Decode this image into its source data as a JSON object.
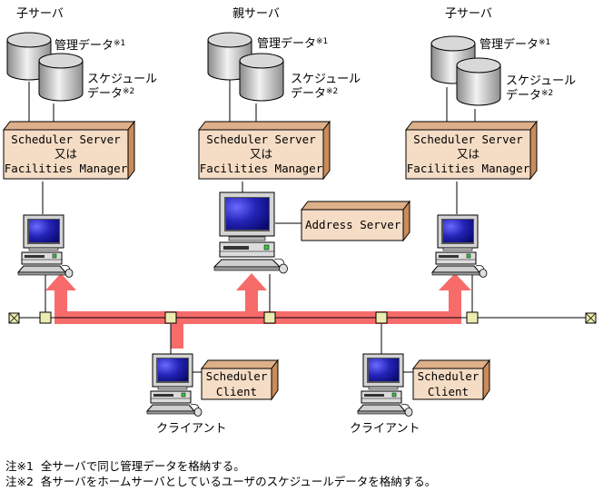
{
  "servers": [
    {
      "title": "子サーバ",
      "db1_label": "管理データ",
      "db1_mark": "※1",
      "db2_label_line1": "スケジュール",
      "db2_label_line2": "データ",
      "db2_mark": "※2",
      "box_line1": "Scheduler Server",
      "box_line2": "又は",
      "box_line3": "Facilities Manager"
    },
    {
      "title": "親サーバ",
      "db1_label": "管理データ",
      "db1_mark": "※1",
      "db2_label_line1": "スケジュール",
      "db2_label_line2": "データ",
      "db2_mark": "※2",
      "box_line1": "Scheduler Server",
      "box_line2": "又は",
      "box_line3": "Facilities Manager"
    },
    {
      "title": "子サーバ",
      "db1_label": "管理データ",
      "db1_mark": "※1",
      "db2_label_line1": "スケジュール",
      "db2_label_line2": "データ",
      "db2_mark": "※2",
      "box_line1": "Scheduler Server",
      "box_line2": "又は",
      "box_line3": "Facilities Manager"
    }
  ],
  "address_server": {
    "label": "Address Server"
  },
  "clients": [
    {
      "box_line1": "Scheduler",
      "box_line2": "Client",
      "caption": "クライアント"
    },
    {
      "box_line1": "Scheduler",
      "box_line2": "Client",
      "caption": "クライアント"
    }
  ],
  "notes": [
    {
      "mark": "注※1",
      "text": "全サーバで同じ管理データを格納する。"
    },
    {
      "mark": "注※2",
      "text": "各サーバをホームサーバとしているユーザのスケジュールデータを格納する。"
    }
  ],
  "colors": {
    "flow_arrow": "#f76b6b",
    "box_front": "#f5dcc5",
    "box_top": "#deb08a",
    "box_side": "#c98c5a",
    "node": "#ececb0",
    "screen": "#1a1aa0"
  }
}
